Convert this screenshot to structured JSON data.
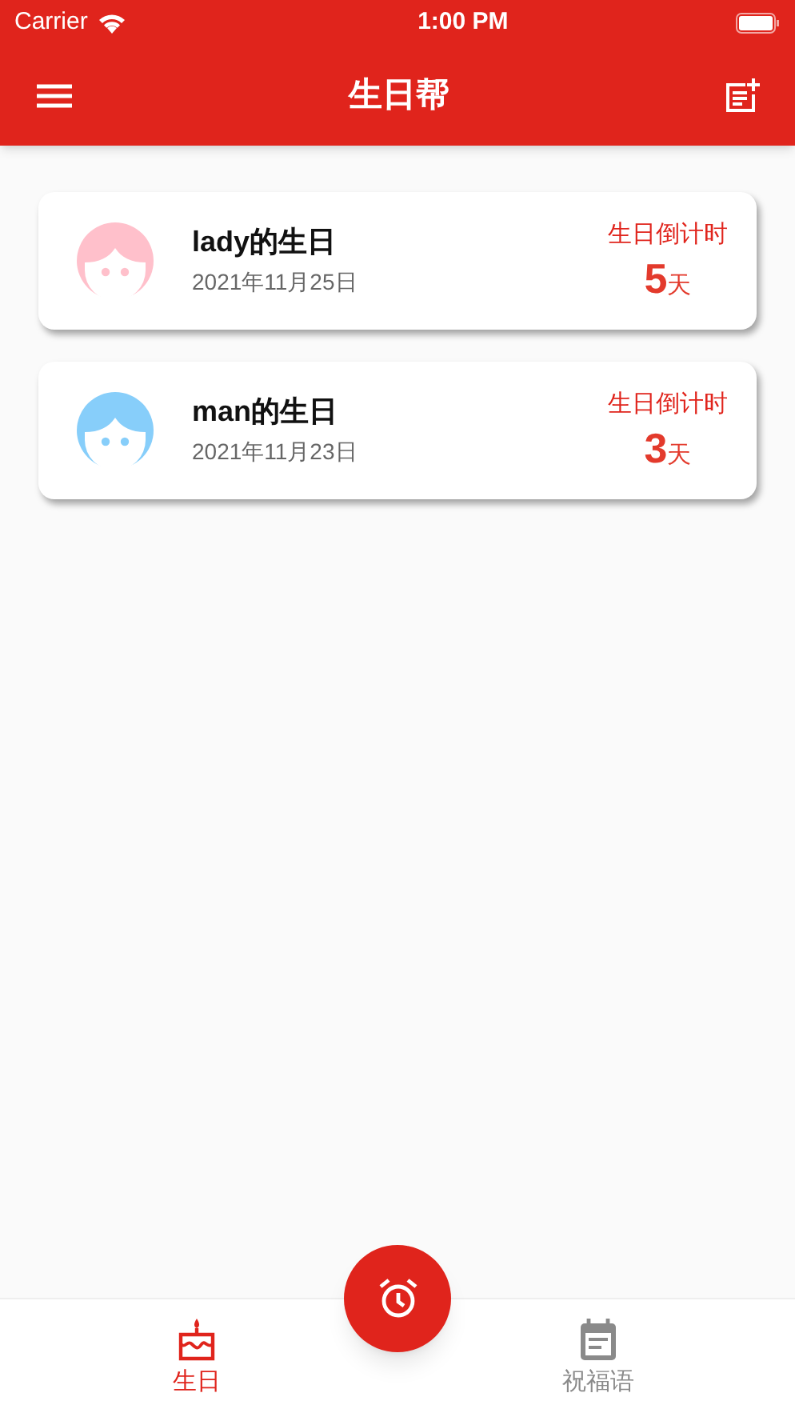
{
  "status_bar": {
    "carrier": "Carrier",
    "time": "1:00 PM"
  },
  "app_bar": {
    "title": "生日帮"
  },
  "cards": [
    {
      "name": "lady的生日",
      "date": "2021年11月25日",
      "countdown_label": "生日倒计时",
      "days": "5",
      "unit": "天",
      "color": "#ffc0cb"
    },
    {
      "name": "man的生日",
      "date": "2021年11月23日",
      "countdown_label": "生日倒计时",
      "days": "3",
      "unit": "天",
      "color": "#87cefa"
    }
  ],
  "tabs": [
    {
      "label": "生日",
      "kind": "cake",
      "selected": true
    },
    {
      "label": "祝福语",
      "kind": "note",
      "selected": false
    }
  ]
}
